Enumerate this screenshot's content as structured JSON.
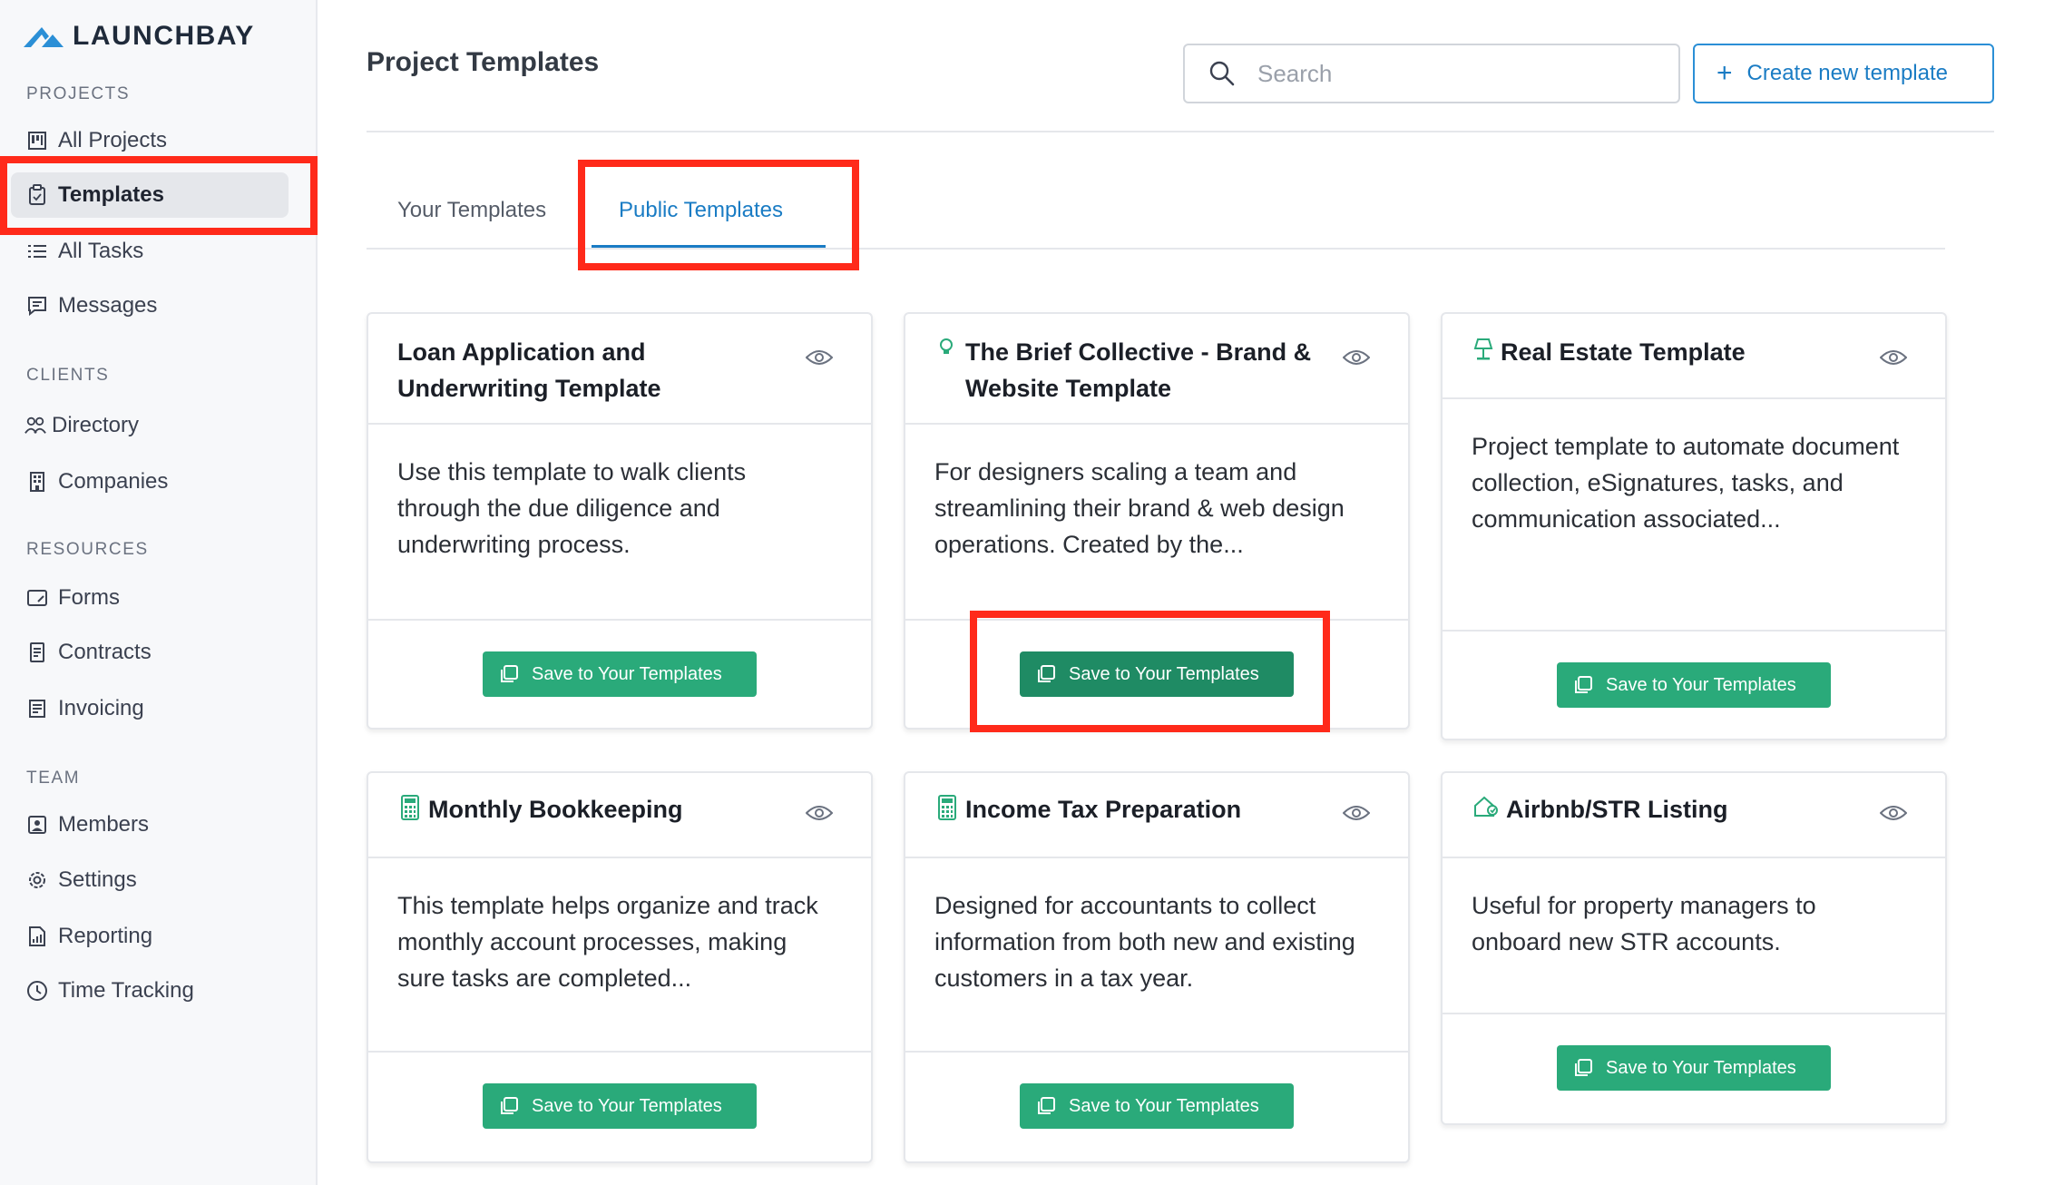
{
  "app": {
    "name": "LAUNCHBAY"
  },
  "sidebar": {
    "sections": {
      "projects": "PROJECTS",
      "clients": "CLIENTS",
      "resources": "RESOURCES",
      "team": "TEAM"
    },
    "items": {
      "all_projects": "All Projects",
      "templates": "Templates",
      "all_tasks": "All Tasks",
      "messages": "Messages",
      "directory": "Directory",
      "companies": "Companies",
      "forms": "Forms",
      "contracts": "Contracts",
      "invoicing": "Invoicing",
      "members": "Members",
      "settings": "Settings",
      "reporting": "Reporting",
      "time_tracking": "Time Tracking"
    },
    "active_item": "Templates"
  },
  "header": {
    "title": "Project Templates",
    "search_placeholder": "Search",
    "create_label": "Create new template"
  },
  "tabs": {
    "your": "Your Templates",
    "public": "Public Templates",
    "active": "Public Templates"
  },
  "save_label": "Save to Your Templates",
  "cards": [
    {
      "title": "Loan Application and Underwriting Template",
      "icon": "",
      "description": "Use this template to walk clients through the due diligence and underwriting process."
    },
    {
      "title": "The Brief Collective - Brand & Website Template",
      "icon": "lightbulb-icon",
      "description": "For designers scaling a team and streamlining their brand & web design operations. Created by the..."
    },
    {
      "title": "Real Estate Template",
      "icon": "lamp-icon",
      "description": "Project template to automate document collection, eSignatures, tasks, and communication associated..."
    },
    {
      "title": "Monthly Bookkeeping",
      "icon": "calculator-icon",
      "description": "This template helps organize and track monthly account processes, making sure tasks are completed..."
    },
    {
      "title": "Income Tax Preparation",
      "icon": "calculator-icon",
      "description": "Designed for accountants to collect information from both new and existing customers in a tax year."
    },
    {
      "title": "Airbnb/STR Listing",
      "icon": "house-icon",
      "description": "Useful for property managers to onboard new STR accounts."
    }
  ],
  "colors": {
    "accent": "#1a7cc4",
    "save_button": "#2aaa7a",
    "highlight": "#ff2a1a"
  }
}
